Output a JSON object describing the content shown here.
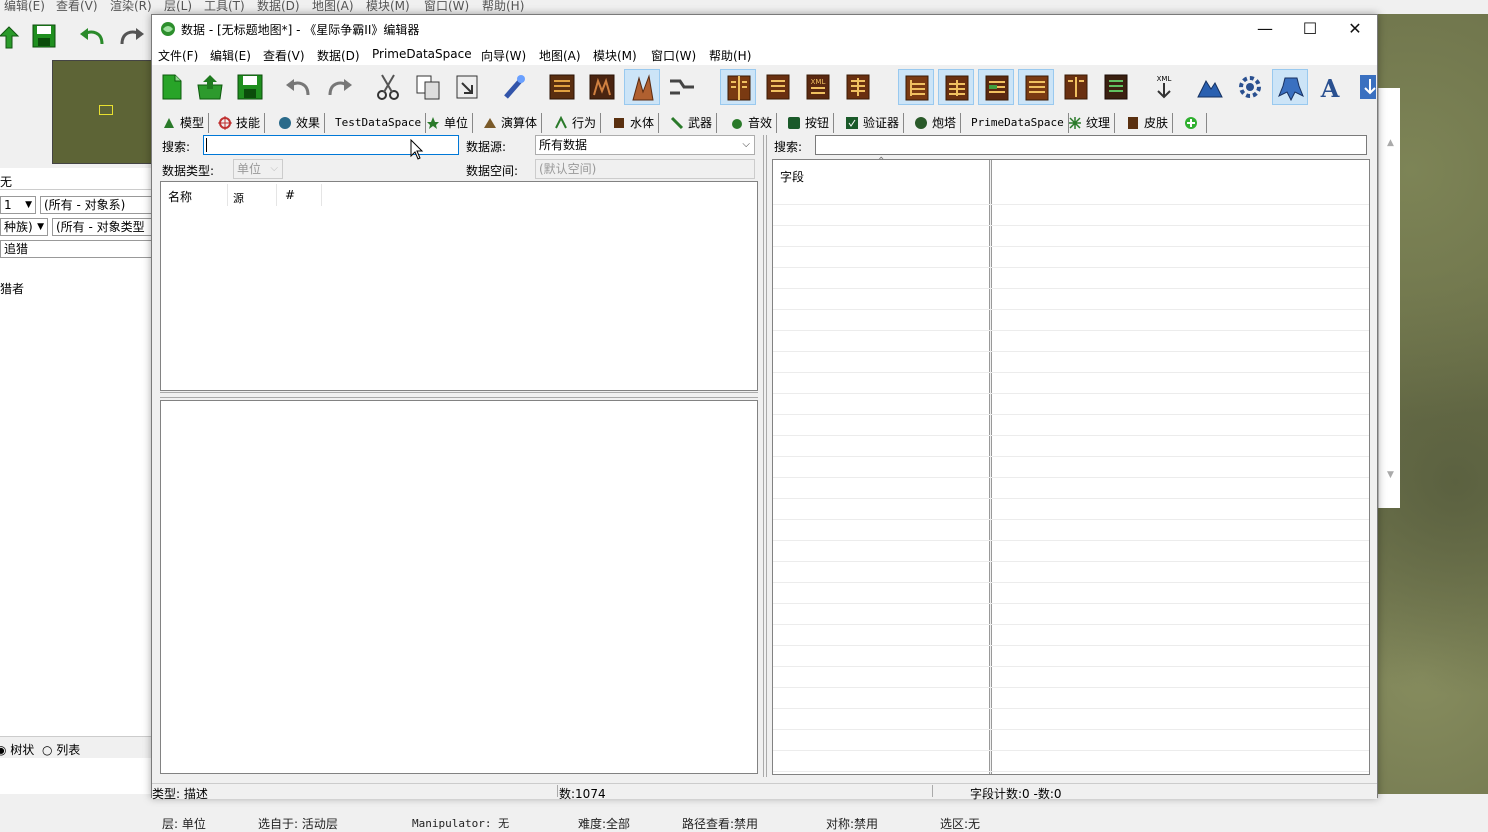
{
  "background_editor": {
    "menu": [
      "编辑(E)",
      "查看(V)",
      "渲染(R)",
      "层(L)",
      "工具(T)",
      "数据(D)",
      "地图(A)",
      "模块(M)",
      "窗口(W)",
      "帮助(H)"
    ],
    "left_panel": {
      "row1": "无",
      "select1_value": "1",
      "select2_value": "(所有 - 对象系)",
      "select3_value": "种族)",
      "select4_value": "(所有 - 对象类型",
      "search_value": "追猎",
      "list_item": "猎者",
      "radio_tree": "树状",
      "radio_list": "列表"
    },
    "statusbar": {
      "layer": "层: 单位",
      "select": "选自于: 活动层",
      "manipulator": "Manipulator: 无",
      "difficulty": "难度:全部",
      "path": "路径查看:禁用",
      "symmetry": "对称:禁用",
      "selection": "选区:无"
    }
  },
  "window": {
    "title": "数据 - [无标题地图*] - 《星际争霸II》编辑器",
    "controls": {
      "minimize": "—",
      "maximize": "☐",
      "close": "✕"
    },
    "menu": [
      "文件(F)",
      "编辑(E)",
      "查看(V)",
      "数据(D)",
      "PrimeDataSpace",
      "向导(W)",
      "地图(A)",
      "模块(M)",
      "窗口(W)",
      "帮助(H)"
    ],
    "toolbar": {
      "xml_label": "XML",
      "text_tool_label": "A"
    },
    "tabs": [
      {
        "label": "模型",
        "icon": "model-icon"
      },
      {
        "label": "技能",
        "icon": "ability-icon"
      },
      {
        "label": "效果",
        "icon": "effect-icon"
      },
      {
        "label": "TestDataSpace",
        "icon": ""
      },
      {
        "label": "单位",
        "icon": "unit-icon"
      },
      {
        "label": "演算体",
        "icon": "actor-icon"
      },
      {
        "label": "行为",
        "icon": "behavior-icon"
      },
      {
        "label": "水体",
        "icon": "water-icon"
      },
      {
        "label": "武器",
        "icon": "weapon-icon"
      },
      {
        "label": "音效",
        "icon": "sound-icon"
      },
      {
        "label": "按钮",
        "icon": "button-icon"
      },
      {
        "label": "验证器",
        "icon": "validator-icon"
      },
      {
        "label": "炮塔",
        "icon": "turret-icon"
      },
      {
        "label": "PrimeDataSpace",
        "icon": ""
      },
      {
        "label": "纹理",
        "icon": "texture-icon"
      },
      {
        "label": "皮肤",
        "icon": "skin-icon"
      }
    ],
    "left": {
      "search_label": "搜索:",
      "search_value": "",
      "datasource_label": "数据源:",
      "datasource_value": "所有数据",
      "datatype_label": "数据类型:",
      "datatype_value": "单位",
      "dataspace_label": "数据空间:",
      "dataspace_value": "(默认空间)",
      "columns": [
        "名称",
        "源",
        "#"
      ]
    },
    "right": {
      "search_label": "搜索:",
      "search_value": "",
      "field_column": "字段"
    },
    "status": {
      "type": "类型: 描述",
      "count": "数:1074",
      "field_count": "字段计数:0 -数:0"
    }
  }
}
